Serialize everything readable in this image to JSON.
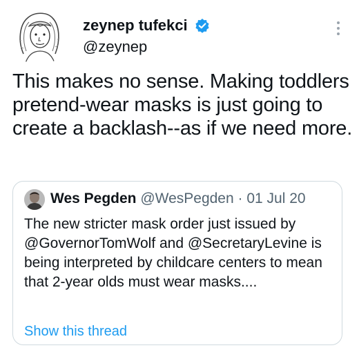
{
  "tweet": {
    "author": {
      "name": "zeynep tufekci",
      "handle": "@zeynep",
      "verified": true,
      "avatar_icon": "sketch-portrait-avatar"
    },
    "text": "This makes no sense. Making toddlers pretend-wear masks is just going to create a backlash--as if we need more.",
    "more_icon": "more-vertical-icon"
  },
  "quote": {
    "author_name": "Wes Pegden",
    "author_handle": "@WesPegden",
    "separator": "·",
    "date": "01 Jul 20",
    "text": "The new stricter mask order just issued by @GovernorTomWolf and @SecretaryLevine is being interpreted by childcare centers to mean that 2-year olds must wear masks....",
    "show_thread_label": "Show this thread"
  },
  "colors": {
    "text": "#0f1419",
    "secondary": "#536471",
    "link": "#1d9bf0",
    "verified_badge": "#1d9bf0",
    "border": "#cfd9de"
  }
}
